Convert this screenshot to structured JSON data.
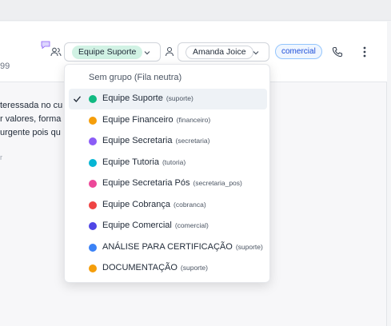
{
  "header": {
    "phone_suffix": "99",
    "team_selected": "Equipe Suporte",
    "agent_selected": "Amanda Joice",
    "tag": "comercial"
  },
  "message": {
    "line1": "teressada no cu",
    "line2": "r valores, forma",
    "line3": "urgente pois qu",
    "time": "r"
  },
  "colors": {
    "team_pill_bg": "#d1f2e4",
    "tag_border": "#93c5fd",
    "tag_text": "#1d4ed8"
  },
  "dropdown": {
    "header": "Sem grupo (Fila neutra)",
    "items": [
      {
        "label": "Equipe Suporte",
        "code": "(suporte)",
        "color": "#10b981",
        "selected": true
      },
      {
        "label": "Equipe Financeiro",
        "code": "(financeiro)",
        "color": "#f59e0b",
        "selected": false
      },
      {
        "label": "Equipe Secretaria",
        "code": "(secretaria)",
        "color": "#8b5cf6",
        "selected": false
      },
      {
        "label": "Equipe Tutoria",
        "code": "(tutoria)",
        "color": "#06b6d4",
        "selected": false
      },
      {
        "label": "Equipe Secretaria Pós",
        "code": "(secretaria_pos)",
        "color": "#ec4899",
        "selected": false
      },
      {
        "label": "Equipe Cobrança",
        "code": "(cobranca)",
        "color": "#ef4444",
        "selected": false
      },
      {
        "label": "Equipe Comercial",
        "code": "(comercial)",
        "color": "#4f46e5",
        "selected": false
      },
      {
        "label": "ANÁLISE PARA CERTIFICAÇÃO",
        "code": "(suporte)",
        "color": "#3b82f6",
        "selected": false
      },
      {
        "label": "DOCUMENTAÇÃO",
        "code": "(suporte)",
        "color": "#f59e0b",
        "selected": false
      }
    ]
  }
}
